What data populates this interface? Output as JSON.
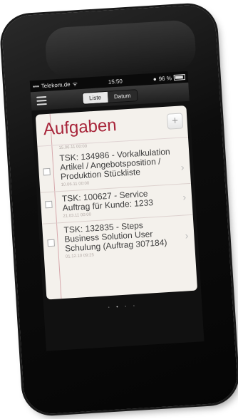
{
  "status": {
    "carrier": "Telekom.de",
    "time": "15:50",
    "battery": "96 %"
  },
  "nav": {
    "tabs": [
      "Liste",
      "Datum"
    ]
  },
  "panel": {
    "title": "Aufgaben",
    "add": "+",
    "prev_date": "15.06.11 00:00"
  },
  "tasks": [
    {
      "text": "TSK: 134986 - Vorkalkulation Artikel / Angebotsposition / Produktion Stückliste",
      "date": "10.06.11 00:00"
    },
    {
      "text": "TSK: 100627 - Service Auftrag für Kunde: 1233",
      "date": "21.03.11 00:00"
    },
    {
      "text": "TSK: 132835 - Steps Business Solution User Schulung (Auftrag 307184)",
      "date": "01.12.10 09:25"
    }
  ]
}
